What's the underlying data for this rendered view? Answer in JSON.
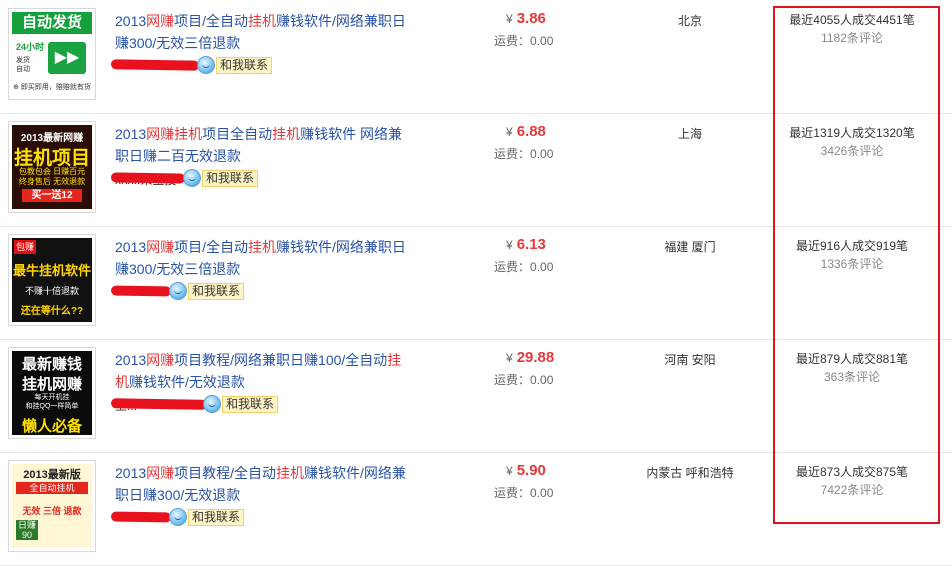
{
  "contact_label": "和我联系",
  "ship_prefix": "运费：",
  "accent_red": "#e4393c",
  "link_blue": "#2953a6",
  "items": [
    {
      "title_parts": [
        {
          "t": "2013",
          "h": false
        },
        {
          "t": "网赚",
          "h": true
        },
        {
          "t": "项目/全自动",
          "h": false
        },
        {
          "t": "挂机",
          "h": true
        },
        {
          "t": "赚钱软件/网络兼职日赚300/无效三倍退款",
          "h": false
        }
      ],
      "seller_visible": "ih....888006",
      "price": "3.86",
      "shipping": "0.00",
      "location": "北京",
      "sales": "最近4055人成交4451笔",
      "reviews": "1182条评论",
      "thumb": {
        "bg": "#ffffff",
        "lines": [
          "自动发货",
          "24小时",
          "发货",
          "自动",
          "▶▶",
          "⊕ 即买即用，赔赔就有货"
        ]
      }
    },
    {
      "title_parts": [
        {
          "t": "2013",
          "h": false
        },
        {
          "t": "网赚",
          "h": true
        },
        {
          "t": "挂机",
          "h": true
        },
        {
          "t": "项目全自动",
          "h": false
        },
        {
          "t": "挂机",
          "h": true
        },
        {
          "t": "赚钱软件 网络兼职日赚二百无效退款",
          "h": false
        }
      ],
      "seller_visible": "xhx..采宝技",
      "price": "6.88",
      "shipping": "0.00",
      "location": "上海",
      "sales": "最近1319人成交1320笔",
      "reviews": "3426条评论",
      "thumb": {
        "bg": "#2a0d06",
        "lines": [
          "2013最新网赚",
          "挂机项目",
          "包教包会 日赚百元",
          "终身售后 无效退款",
          "买一送12"
        ]
      }
    },
    {
      "title_parts": [
        {
          "t": "2013",
          "h": false
        },
        {
          "t": "网赚",
          "h": true
        },
        {
          "t": "项目/全自动",
          "h": false
        },
        {
          "t": "挂机",
          "h": true
        },
        {
          "t": "赚钱软件/网络兼职日赚300/无效三倍退款",
          "h": false
        }
      ],
      "seller_visible": "",
      "price": "6.13",
      "shipping": "0.00",
      "location": "福建 厦门",
      "sales": "最近916人成交919笔",
      "reviews": "1336条评论",
      "thumb": {
        "bg": "#111111",
        "lines": [
          "包赚",
          "最牛挂机软件",
          "不赚十倍退款",
          "还在等什么??"
        ]
      }
    },
    {
      "title_parts": [
        {
          "t": "2013",
          "h": false
        },
        {
          "t": "网赚",
          "h": true
        },
        {
          "t": "项目教程/网络兼职日赚100/全自动",
          "h": false
        },
        {
          "t": "挂机",
          "h": true
        },
        {
          "t": "赚钱软件/无效退款",
          "h": false
        }
      ],
      "seller_visible": "上...",
      "price": "29.88",
      "shipping": "0.00",
      "location": "河南 安阳",
      "sales": "最近879人成交881笔",
      "reviews": "363条评论",
      "thumb": {
        "bg": "#0b0b0b",
        "lines": [
          "最新赚钱",
          "挂机网赚",
          "每天开机挂",
          "和挂QQ一样简单",
          "懒人必备"
        ]
      }
    },
    {
      "title_parts": [
        {
          "t": "2013",
          "h": false
        },
        {
          "t": "网赚",
          "h": true
        },
        {
          "t": "项目教程/全自动",
          "h": false
        },
        {
          "t": "挂机",
          "h": true
        },
        {
          "t": "赚钱软件/网络兼职日赚300/无效退款",
          "h": false
        }
      ],
      "seller_visible": "",
      "price": "5.90",
      "shipping": "0.00",
      "location": "内蒙古 呼和浩特",
      "sales": "最近873人成交875笔",
      "reviews": "7422条评论",
      "thumb": {
        "bg": "#fff6d6",
        "lines": [
          "2013最新版",
          "全自动挂机",
          "无效 三倍 退款",
          "日赚",
          "90"
        ]
      }
    }
  ]
}
